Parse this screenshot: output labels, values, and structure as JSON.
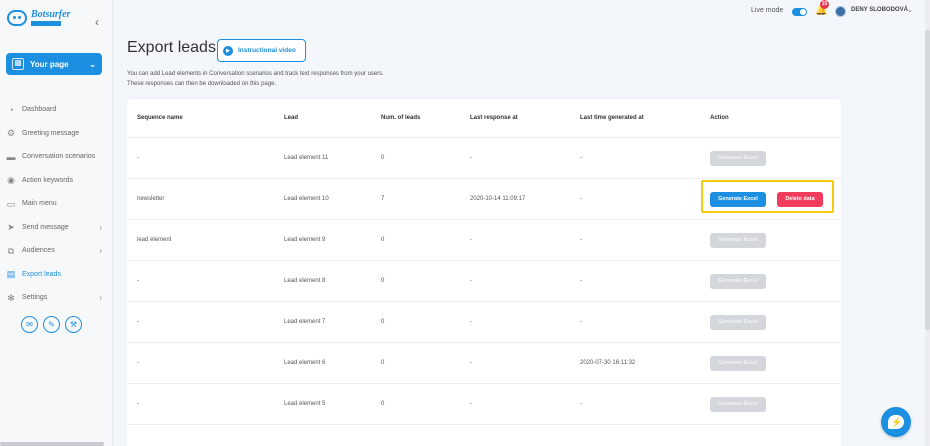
{
  "sidebar": {
    "logo_text": "Botsurfer",
    "collapse_icon": "chevron-left-icon",
    "page_selector": "Your page",
    "items": [
      {
        "label": "Dashboard",
        "icon": "dashboard-icon",
        "has_arrow": false
      },
      {
        "label": "Greeting message",
        "icon": "greeting-icon",
        "has_arrow": false
      },
      {
        "label": "Conversation scenarios",
        "icon": "folder-icon",
        "has_arrow": false
      },
      {
        "label": "Action keywords",
        "icon": "keywords-icon",
        "has_arrow": false
      },
      {
        "label": "Main menu",
        "icon": "menu-icon",
        "has_arrow": false
      },
      {
        "label": "Send message",
        "icon": "send-icon",
        "has_arrow": true
      },
      {
        "label": "Audiences",
        "icon": "audiences-icon",
        "has_arrow": true
      },
      {
        "label": "Export leads",
        "icon": "export-icon",
        "has_arrow": false,
        "active": true
      },
      {
        "label": "Settings",
        "icon": "gear-icon",
        "has_arrow": true
      }
    ],
    "social_icons": [
      "chat-icon",
      "brush-icon",
      "tools-icon"
    ]
  },
  "topbar": {
    "live_mode_label": "Live mode",
    "live_mode_on": true,
    "notification_count": "15",
    "user_name": "DENY SLOBODOVÁ"
  },
  "main": {
    "title": "Export leads",
    "video_button": "Instructional video",
    "description_line1": "You can add Lead elements in Conversation scenarios and track text responses from your users.",
    "description_line2": "These responses can then be downloaded on this page."
  },
  "table": {
    "headers": [
      "Sequence name",
      "Lead",
      "Num. of leads",
      "Last response at",
      "Last time generated at",
      "Action"
    ],
    "generate_label": "Generate Excel",
    "delete_label": "Delete data",
    "rows": [
      {
        "sequence": "-",
        "lead": "Lead element 11",
        "num": "0",
        "last_response": "-",
        "last_generated": "-",
        "enabled": false
      },
      {
        "sequence": "newsletter",
        "lead": "Lead element 10",
        "num": "7",
        "last_response": "2020-10-14 11:09:17",
        "last_generated": "-",
        "enabled": true
      },
      {
        "sequence": "lead element",
        "lead": "Lead element 9",
        "num": "0",
        "last_response": "-",
        "last_generated": "-",
        "enabled": false
      },
      {
        "sequence": "-",
        "lead": "Lead element 8",
        "num": "0",
        "last_response": "-",
        "last_generated": "-",
        "enabled": false
      },
      {
        "sequence": "-",
        "lead": "Lead element 7",
        "num": "0",
        "last_response": "-",
        "last_generated": "-",
        "enabled": false
      },
      {
        "sequence": "-",
        "lead": "Lead element 6",
        "num": "0",
        "last_response": "-",
        "last_generated": "2020-07-30 16:11:32",
        "enabled": false
      },
      {
        "sequence": "-",
        "lead": "Lead element 5",
        "num": "0",
        "last_response": "-",
        "last_generated": "-",
        "enabled": false
      }
    ]
  },
  "colors": {
    "accent": "#1d8fe1",
    "danger": "#ef3d5b",
    "highlight": "#f5c90c"
  }
}
